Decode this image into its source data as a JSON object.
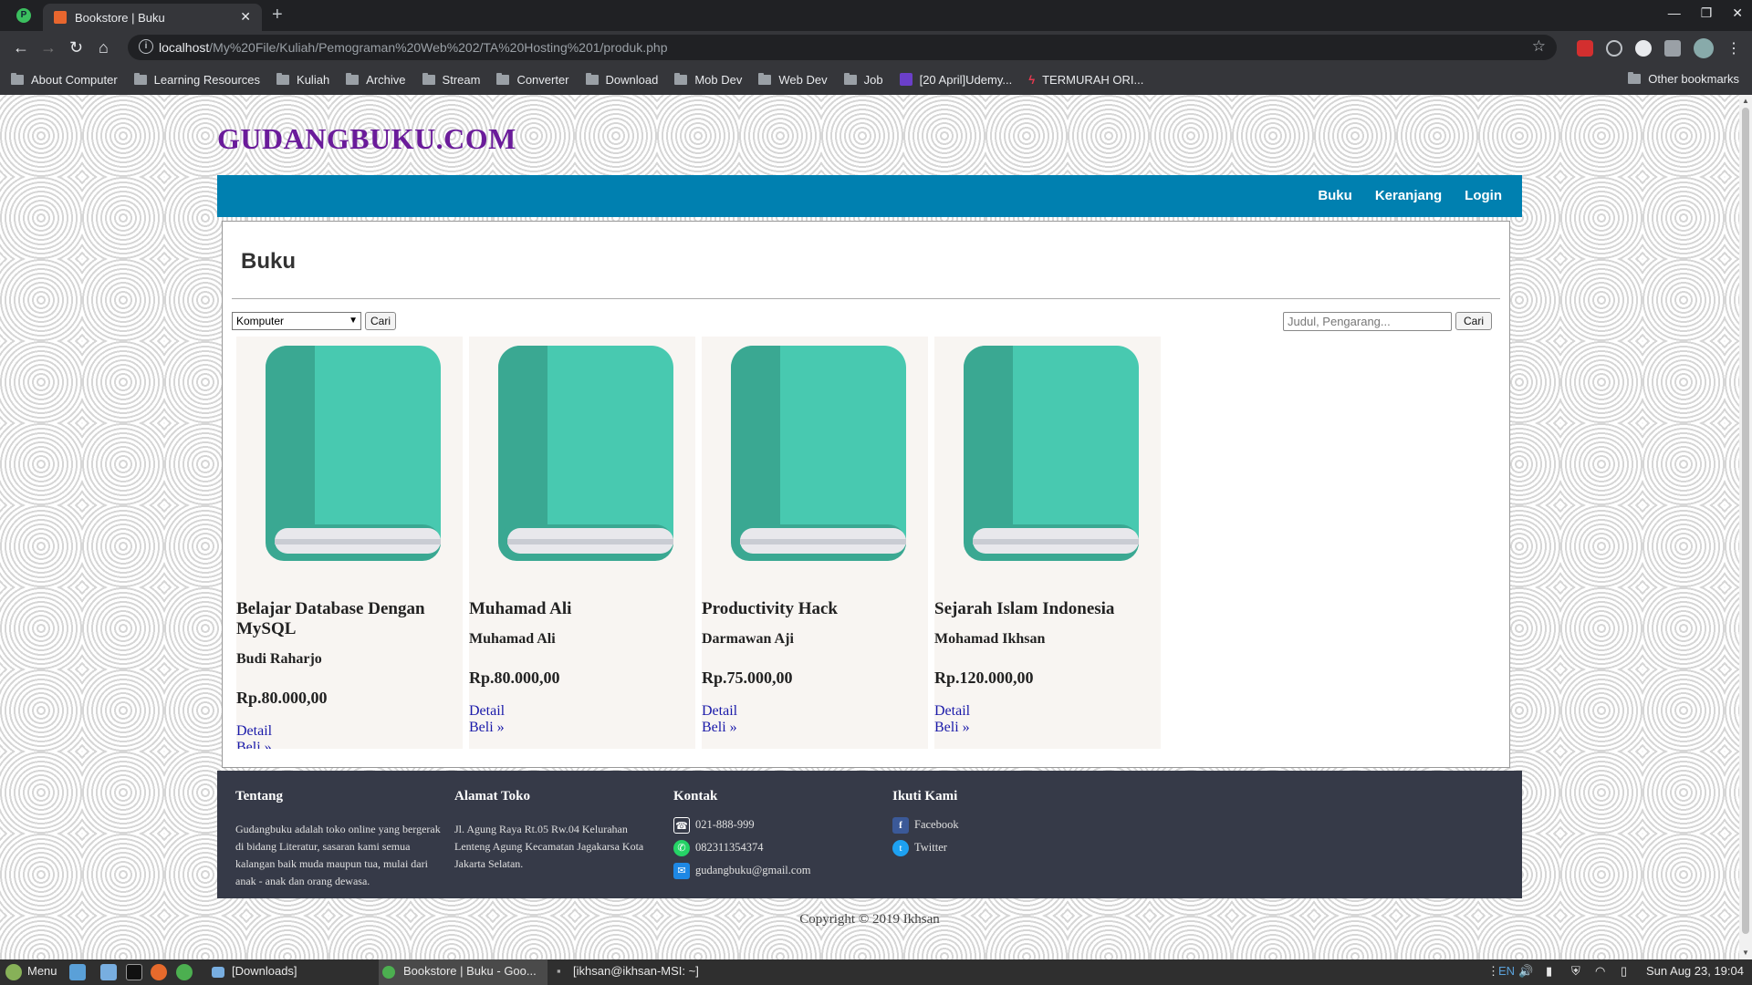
{
  "browser": {
    "tab_title": "Bookstore | Buku",
    "url_host": "localhost",
    "url_path": "/My%20File/Kuliah/Pemograman%20Web%202/TA%20Hosting%201/produk.php",
    "bookmarks": [
      "About Computer",
      "Learning Resources",
      "Kuliah",
      "Archive",
      "Stream",
      "Converter",
      "Download",
      "Mob Dev",
      "Web Dev",
      "Job",
      "[20 April]Udemy...",
      "TERMURAH ORI..."
    ],
    "other_bookmarks": "Other bookmarks"
  },
  "site": {
    "title": "GUDANGBUKU.COM",
    "nav": [
      "Buku",
      "Keranjang",
      "Login"
    ]
  },
  "page": {
    "heading": "Buku",
    "category_selected": "Komputer",
    "filter_button": "Cari",
    "search_placeholder": "Judul, Pengarang...",
    "search_button": "Cari"
  },
  "products": [
    {
      "title": "Belajar Database Dengan MySQL",
      "author": "Budi Raharjo",
      "price": "Rp.80.000,00",
      "detail": "Detail",
      "buy": "Beli »"
    },
    {
      "title": "Muhamad Ali",
      "author": "Muhamad Ali",
      "price": "Rp.80.000,00",
      "detail": "Detail",
      "buy": "Beli »"
    },
    {
      "title": "Productivity Hack",
      "author": "Darmawan Aji",
      "price": "Rp.75.000,00",
      "detail": "Detail",
      "buy": "Beli »"
    },
    {
      "title": "Sejarah Islam Indonesia",
      "author": "Mohamad Ikhsan",
      "price": "Rp.120.000,00",
      "detail": "Detail",
      "buy": "Beli »"
    }
  ],
  "footer": {
    "about_heading": "Tentang",
    "about_text": "Gudangbuku adalah toko online yang bergerak di bidang Literatur, sasaran kami semua kalangan baik muda maupun tua, mulai dari anak - anak dan orang dewasa.",
    "address_heading": "Alamat Toko",
    "address_text": "Jl. Agung Raya Rt.05 Rw.04 Kelurahan Lenteng Agung Kecamatan Jagakarsa Kota Jakarta Selatan.",
    "contact_heading": "Kontak",
    "phone": "021-888-999",
    "whatsapp": "082311354374",
    "email": "gudangbuku@gmail.com",
    "follow_heading": "Ikuti Kami",
    "facebook": "Facebook",
    "twitter": "Twitter",
    "copyright": "Copyright © 2019 Ikhsan"
  },
  "taskbar": {
    "menu": "Menu",
    "downloads": "[Downloads]",
    "browser_window": "Bookstore | Buku - Goo...",
    "terminal": "[ikhsan@ikhsan-MSI: ~]",
    "lang": "EN",
    "clock": "Sun Aug 23, 19:04"
  },
  "colors": {
    "nav_bg": "#0080b0",
    "title": "#6a1b9a",
    "book_main": "#48c9b0",
    "book_spine": "#3aa892",
    "footer_bg": "#363a48"
  }
}
